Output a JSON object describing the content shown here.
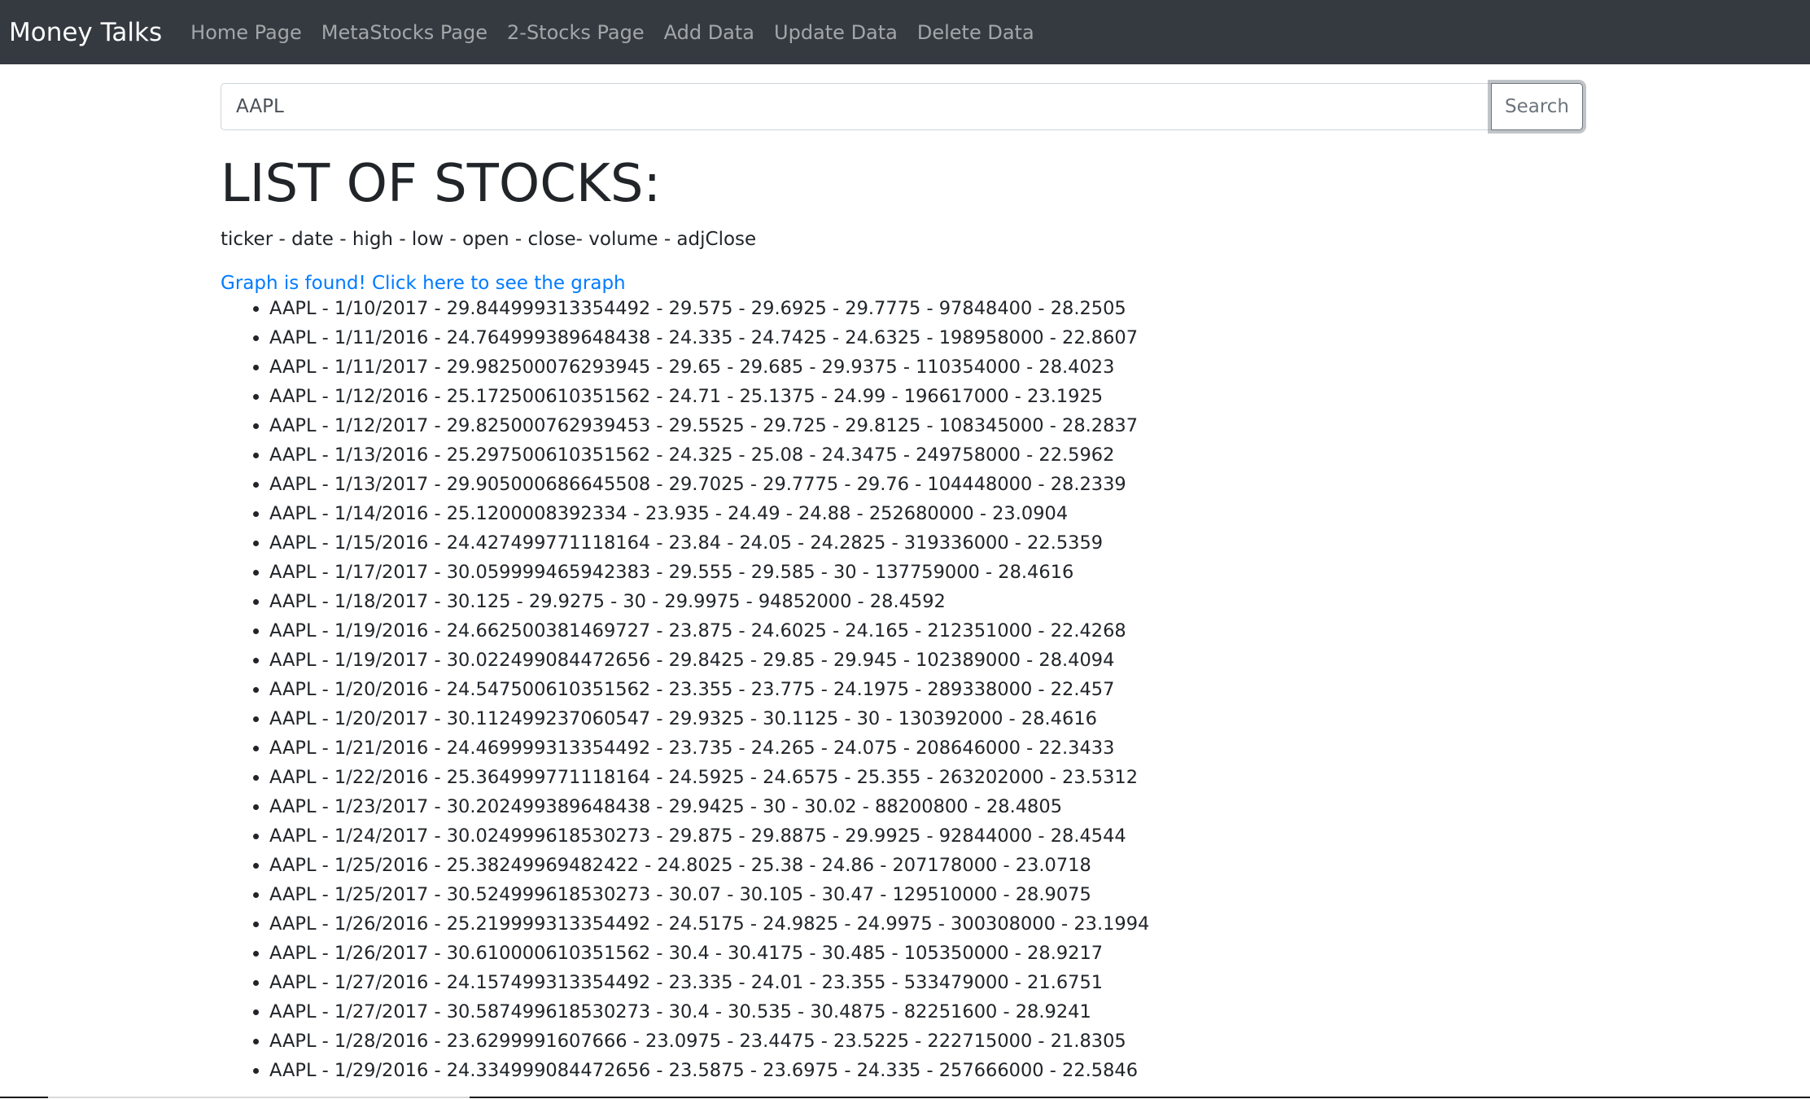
{
  "navbar": {
    "brand": "Money Talks",
    "links": [
      "Home Page",
      "MetaStocks Page",
      "2-Stocks Page",
      "Add Data",
      "Update Data",
      "Delete Data"
    ]
  },
  "search": {
    "value": "AAPL",
    "button_label": "Search"
  },
  "main": {
    "title": "LIST OF STOCKS:",
    "fields": "ticker - date - high - low - open - close- volume - adjClose",
    "graph_link": "Graph is found! Click here to see the graph",
    "stocks": [
      "AAPL - 1/10/2017 - 29.844999313354492 - 29.575 - 29.6925 - 29.7775 - 97848400 - 28.2505",
      "AAPL - 1/11/2016 - 24.764999389648438 - 24.335 - 24.7425 - 24.6325 - 198958000 - 22.8607",
      "AAPL - 1/11/2017 - 29.982500076293945 - 29.65 - 29.685 - 29.9375 - 110354000 - 28.4023",
      "AAPL - 1/12/2016 - 25.172500610351562 - 24.71 - 25.1375 - 24.99 - 196617000 - 23.1925",
      "AAPL - 1/12/2017 - 29.825000762939453 - 29.5525 - 29.725 - 29.8125 - 108345000 - 28.2837",
      "AAPL - 1/13/2016 - 25.297500610351562 - 24.325 - 25.08 - 24.3475 - 249758000 - 22.5962",
      "AAPL - 1/13/2017 - 29.905000686645508 - 29.7025 - 29.7775 - 29.76 - 104448000 - 28.2339",
      "AAPL - 1/14/2016 - 25.1200008392334 - 23.935 - 24.49 - 24.88 - 252680000 - 23.0904",
      "AAPL - 1/15/2016 - 24.427499771118164 - 23.84 - 24.05 - 24.2825 - 319336000 - 22.5359",
      "AAPL - 1/17/2017 - 30.059999465942383 - 29.555 - 29.585 - 30 - 137759000 - 28.4616",
      "AAPL - 1/18/2017 - 30.125 - 29.9275 - 30 - 29.9975 - 94852000 - 28.4592",
      "AAPL - 1/19/2016 - 24.662500381469727 - 23.875 - 24.6025 - 24.165 - 212351000 - 22.4268",
      "AAPL - 1/19/2017 - 30.022499084472656 - 29.8425 - 29.85 - 29.945 - 102389000 - 28.4094",
      "AAPL - 1/20/2016 - 24.547500610351562 - 23.355 - 23.775 - 24.1975 - 289338000 - 22.457",
      "AAPL - 1/20/2017 - 30.112499237060547 - 29.9325 - 30.1125 - 30 - 130392000 - 28.4616",
      "AAPL - 1/21/2016 - 24.469999313354492 - 23.735 - 24.265 - 24.075 - 208646000 - 22.3433",
      "AAPL - 1/22/2016 - 25.364999771118164 - 24.5925 - 24.6575 - 25.355 - 263202000 - 23.5312",
      "AAPL - 1/23/2017 - 30.202499389648438 - 29.9425 - 30 - 30.02 - 88200800 - 28.4805",
      "AAPL - 1/24/2017 - 30.024999618530273 - 29.875 - 29.8875 - 29.9925 - 92844000 - 28.4544",
      "AAPL - 1/25/2016 - 25.38249969482422 - 24.8025 - 25.38 - 24.86 - 207178000 - 23.0718",
      "AAPL - 1/25/2017 - 30.524999618530273 - 30.07 - 30.105 - 30.47 - 129510000 - 28.9075",
      "AAPL - 1/26/2016 - 25.219999313354492 - 24.5175 - 24.9825 - 24.9975 - 300308000 - 23.1994",
      "AAPL - 1/26/2017 - 30.610000610351562 - 30.4 - 30.4175 - 30.485 - 105350000 - 28.9217",
      "AAPL - 1/27/2016 - 24.157499313354492 - 23.335 - 24.01 - 23.355 - 533479000 - 21.6751",
      "AAPL - 1/27/2017 - 30.587499618530273 - 30.4 - 30.535 - 30.4875 - 82251600 - 28.9241",
      "AAPL - 1/28/2016 - 23.6299991607666 - 23.0975 - 23.4475 - 23.5225 - 222715000 - 21.8305",
      "AAPL - 1/29/2016 - 24.334999084472656 - 23.5875 - 23.6975 - 24.335 - 257666000 - 22.5846"
    ]
  }
}
